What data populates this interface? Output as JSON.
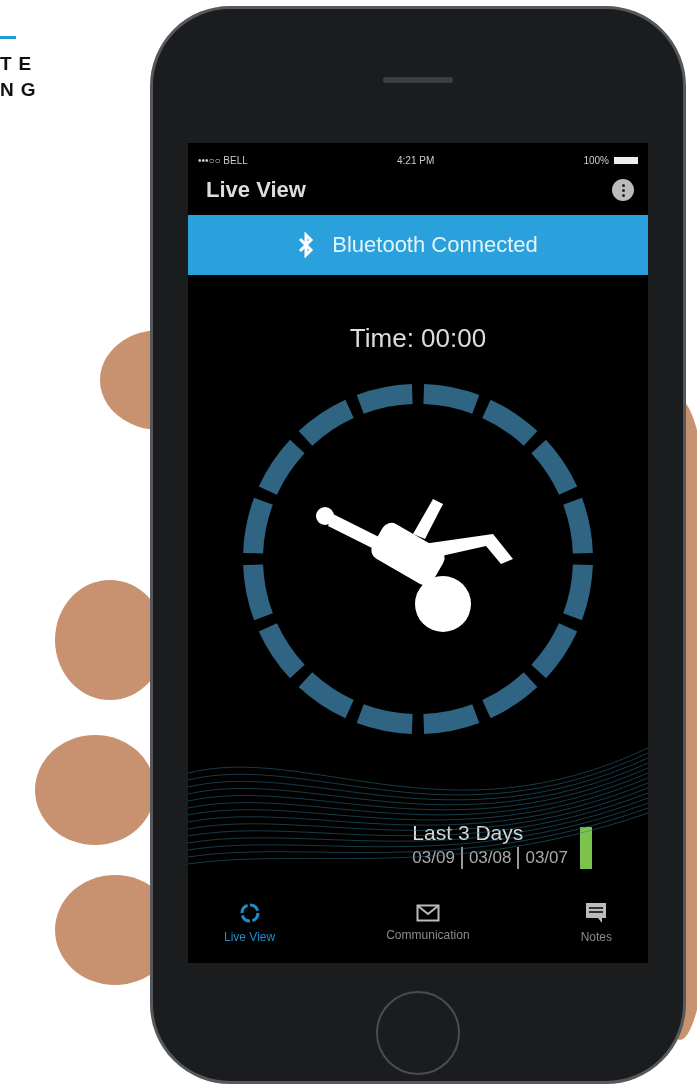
{
  "logo_lines": [
    "TE",
    "NG"
  ],
  "status_bar": {
    "carrier": "•••○○ BELL",
    "time": "4:21 PM",
    "battery": "100%"
  },
  "header": {
    "title": "Live View"
  },
  "banner": {
    "text": "Bluetooth Connected"
  },
  "timer": "Time: 00:00",
  "history": {
    "title": "Last 3 Days",
    "dates": [
      "03/09",
      "03/08",
      "03/07"
    ]
  },
  "tabs": [
    {
      "label": "Live View",
      "kind": "ring",
      "selected": true
    },
    {
      "label": "Communication",
      "kind": "mail",
      "selected": false
    },
    {
      "label": "Notes",
      "kind": "note",
      "selected": false
    }
  ]
}
